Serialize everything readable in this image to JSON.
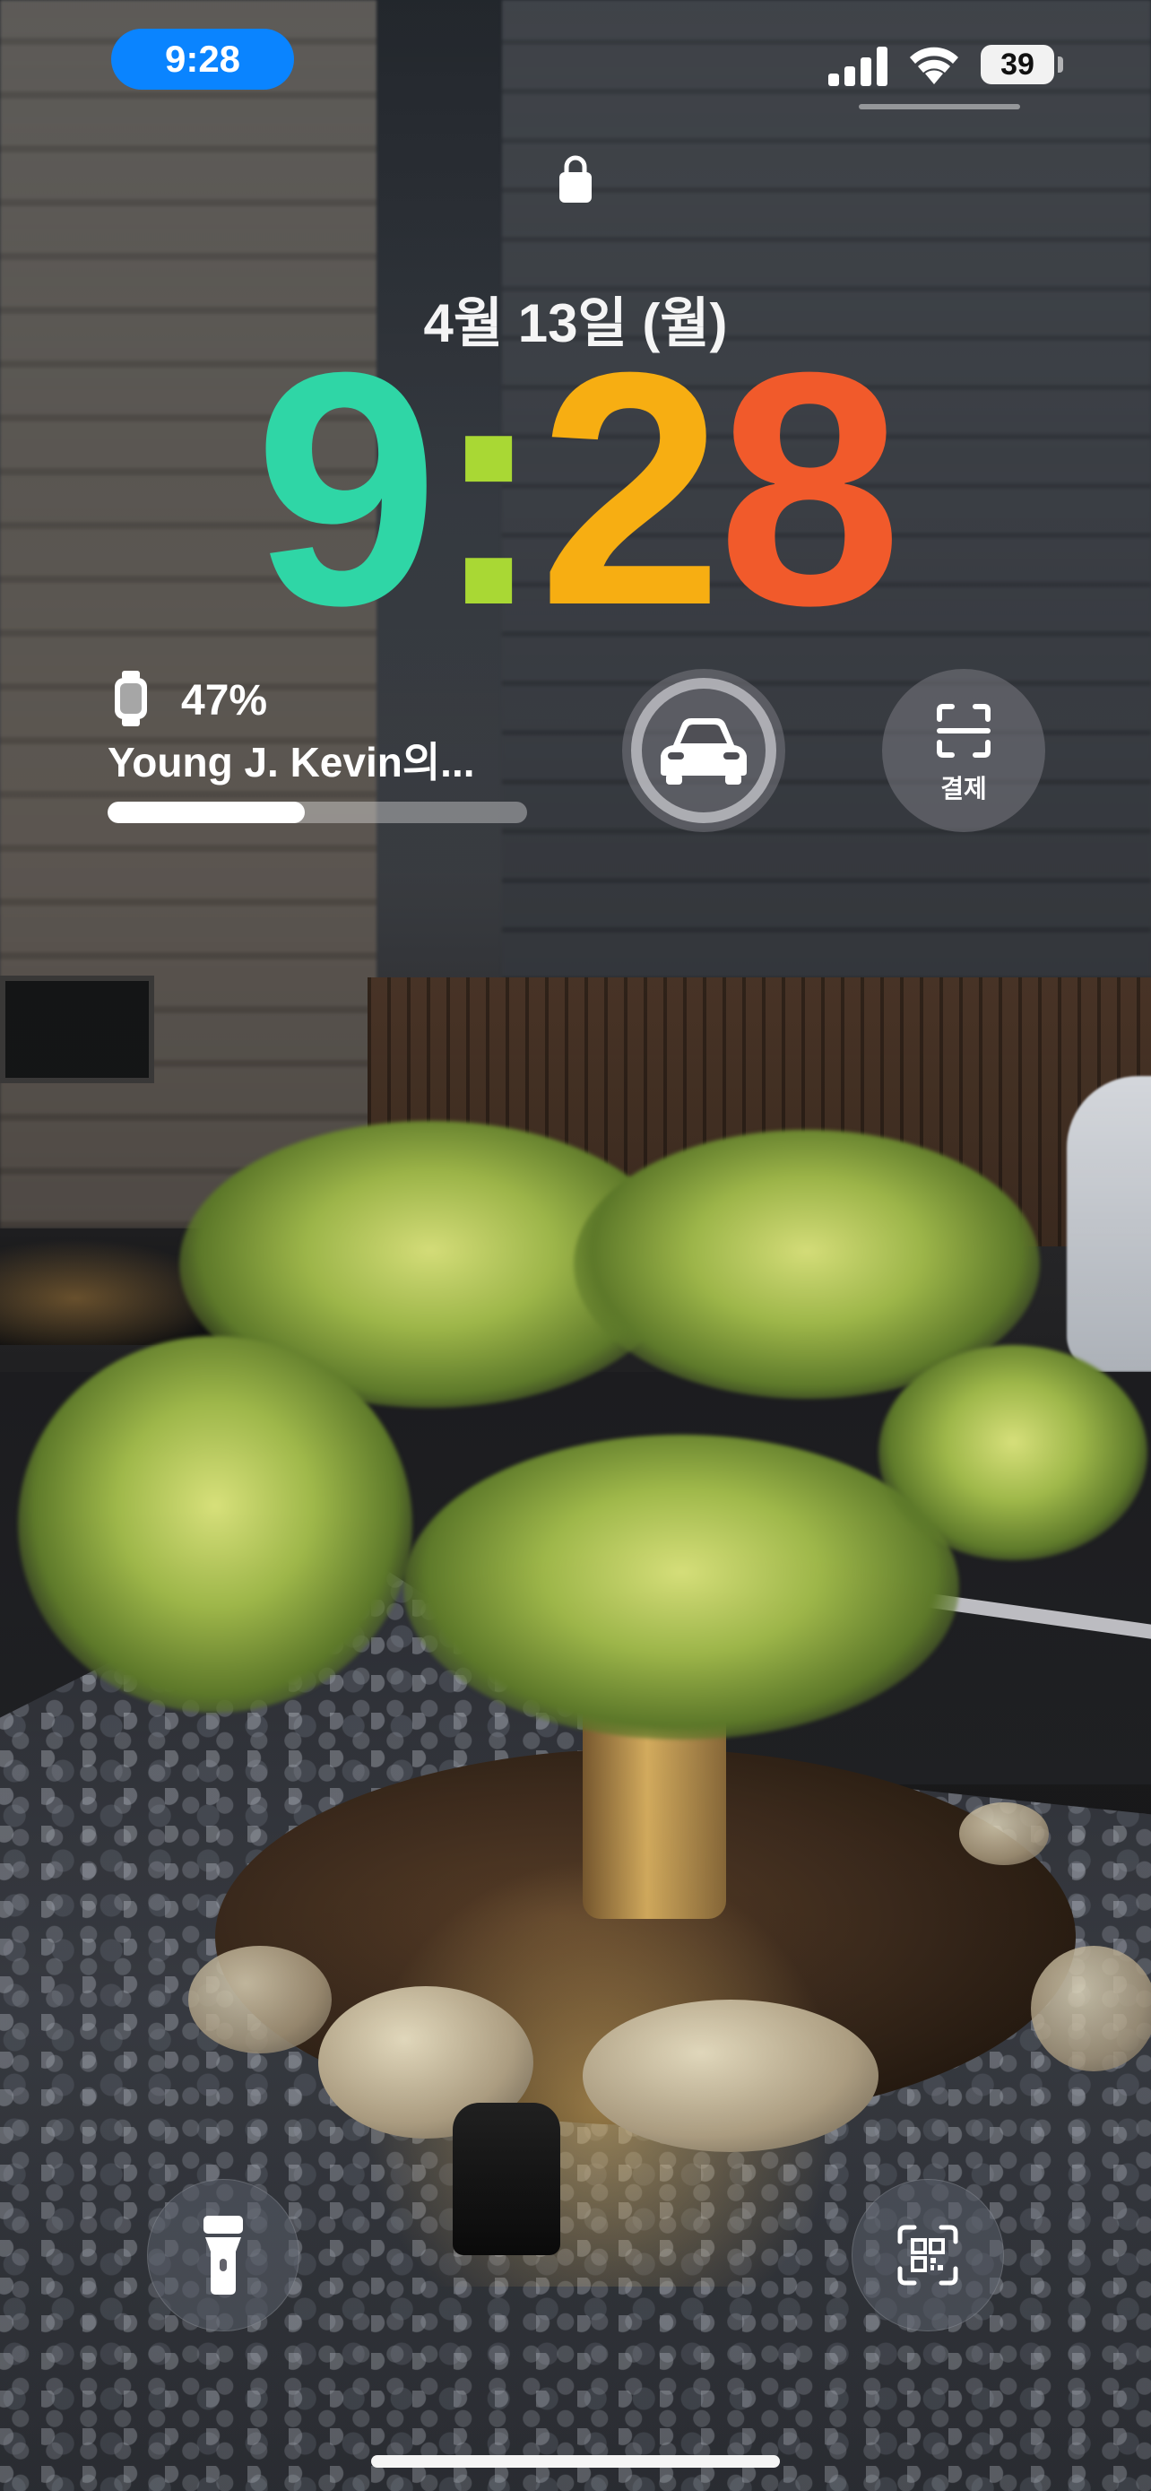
{
  "status_bar": {
    "time": "9:28",
    "battery_level": "39",
    "signal_icon": "cellular-signal-icon",
    "wifi_icon": "wifi-icon",
    "time_pill_color": "#0a84ff"
  },
  "lock_screen": {
    "lock_icon": "lock-icon",
    "date": "4월 13일 (월)",
    "clock": {
      "digits": [
        "9",
        ":",
        "2",
        "8"
      ],
      "colors": [
        "#2fd6a6",
        "#a9d834",
        "#f7ae12",
        "#f15a2b"
      ]
    }
  },
  "widgets": {
    "watch_battery": {
      "icon": "apple-watch-icon",
      "percent_label": "47%",
      "level": 0.47,
      "device_name": "Young J. Kevin의..."
    },
    "car": {
      "icon": "car-icon"
    },
    "payment": {
      "icon": "scan-icon",
      "label": "결제"
    }
  },
  "quick_actions": {
    "left": {
      "icon": "flashlight-icon"
    },
    "right": {
      "icon": "qr-code-scanner-icon"
    }
  }
}
